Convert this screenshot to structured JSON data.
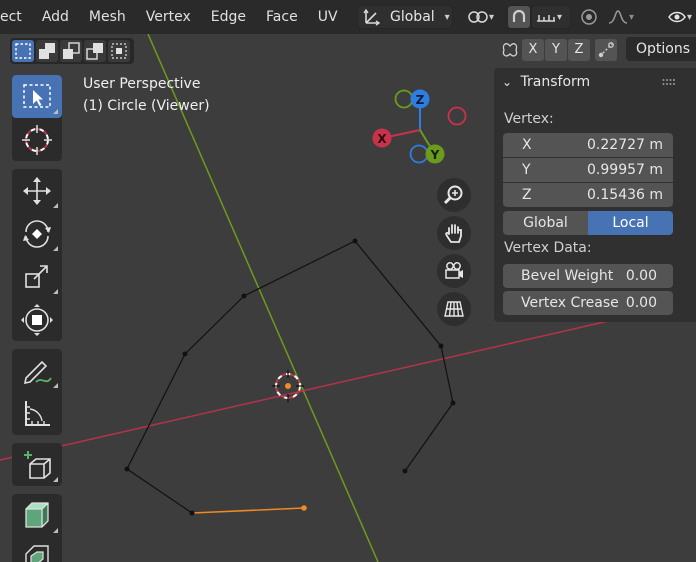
{
  "menu": [
    "ect",
    "Add",
    "Mesh",
    "Vertex",
    "Edge",
    "Face",
    "UV"
  ],
  "header": {
    "orientation_label": "Global"
  },
  "viewport": {
    "perspective": "User Perspective",
    "object": "(1) Circle (Viewer)"
  },
  "axis_header": {
    "x": "X",
    "y": "Y",
    "z": "Z",
    "options": "Options"
  },
  "gizmo": {
    "x": "X",
    "y": "Y",
    "z": "Z"
  },
  "panel": {
    "title": "Transform",
    "vertex_label": "Vertex:",
    "fields": [
      {
        "axis": "X",
        "value": "0.22727 m"
      },
      {
        "axis": "Y",
        "value": "0.99957 m"
      },
      {
        "axis": "Z",
        "value": "0.15436 m"
      }
    ],
    "toggle": {
      "global": "Global",
      "local": "Local"
    },
    "vertex_data_label": "Vertex Data:",
    "bevel": {
      "label": "Bevel Weight",
      "value": "0.00"
    },
    "crease": {
      "label": "Vertex Crease",
      "value": "0.00"
    }
  },
  "icons": {
    "toolbar": [
      "select-box-icon",
      "cursor-icon",
      "move-icon",
      "rotate-icon",
      "scale-icon",
      "transform-icon",
      "annotate-icon",
      "measure-icon",
      "add-cube-icon",
      "extrude-icon",
      "inset-icon"
    ],
    "nav": [
      "zoom-icon",
      "hand-pan-icon",
      "camera-icon",
      "grid-ortho-icon"
    ]
  },
  "colors": {
    "accent": "#4772b3",
    "axis_x": "#c9324a",
    "axis_y": "#6c9b1e",
    "axis_z": "#2e7de0",
    "selected_edge": "#f08a24"
  }
}
